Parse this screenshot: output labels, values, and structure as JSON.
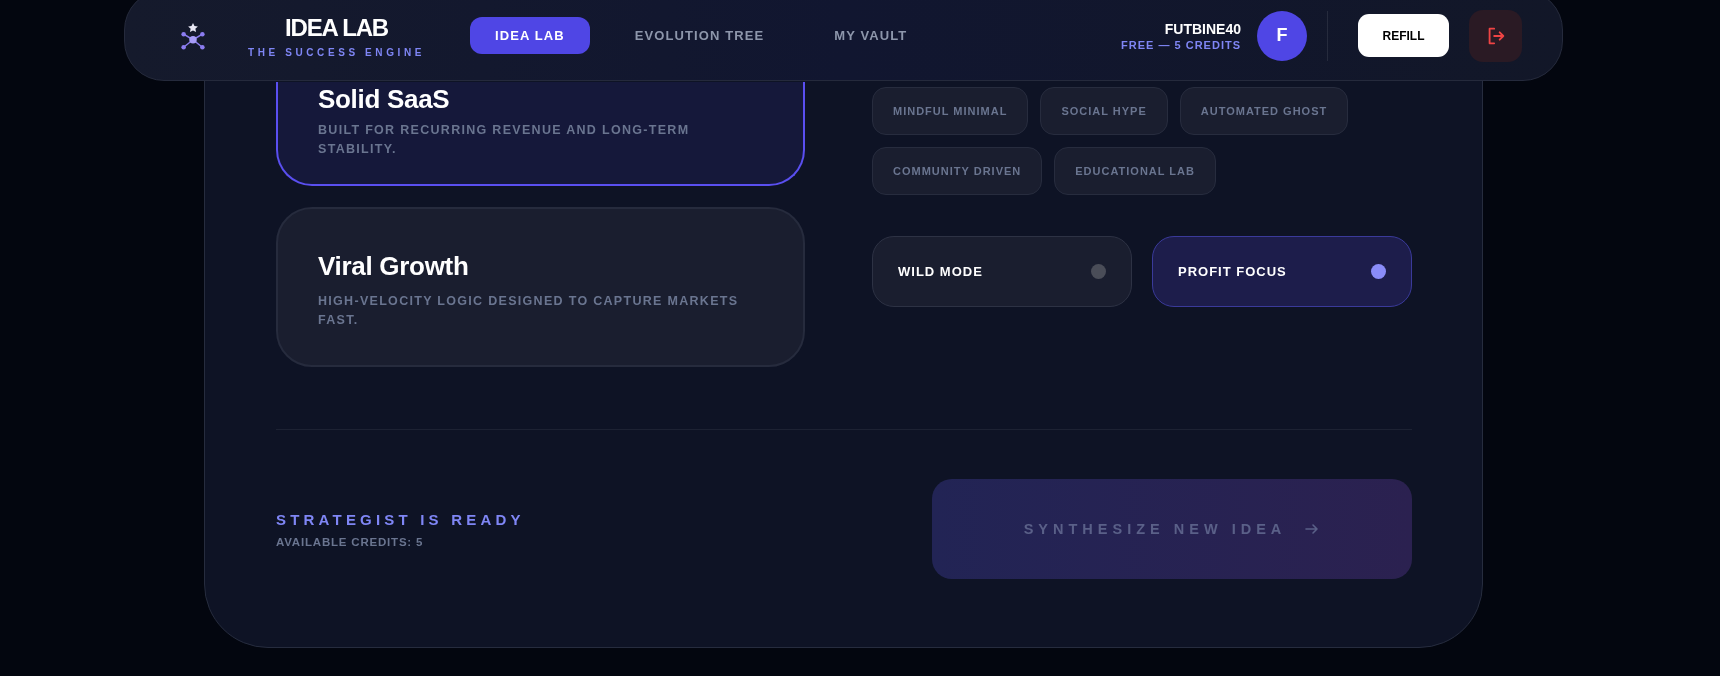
{
  "header": {
    "brand": {
      "title": "IDEA LAB",
      "subtitle": "THE SUCCESS ENGINE"
    },
    "nav": [
      {
        "label": "IDEA LAB",
        "selected": true
      },
      {
        "label": "EVOLUTION TREE",
        "selected": false
      },
      {
        "label": "MY VAULT",
        "selected": false
      }
    ],
    "user": {
      "name": "FUTBINE40",
      "plan": "FREE — 5 CREDITS",
      "avatar_initial": "F"
    },
    "refill_button": "REFILL"
  },
  "strategies": [
    {
      "title": "Solid SaaS",
      "description": "BUILT FOR RECURRING REVENUE AND LONG-TERM STABILITY.",
      "selected": true
    },
    {
      "title": "Viral Growth",
      "description": "HIGH-VELOCITY LOGIC DESIGNED TO CAPTURE MARKETS FAST.",
      "selected": false
    }
  ],
  "styles": [
    {
      "label": "MINDFUL MINIMAL",
      "selected": false
    },
    {
      "label": "SOCIAL HYPE",
      "selected": false
    },
    {
      "label": "AUTOMATED GHOST",
      "selected": false
    },
    {
      "label": "COMMUNITY DRIVEN",
      "selected": false
    },
    {
      "label": "EDUCATIONAL LAB",
      "selected": false
    }
  ],
  "toggles": [
    {
      "label": "WILD MODE",
      "on": false
    },
    {
      "label": "PROFIT FOCUS",
      "on": true
    }
  ],
  "footer": {
    "status": "STRATEGIST IS READY",
    "credits": "AVAILABLE CREDITS: 5",
    "action_button": {
      "label": "SYNTHESIZE NEW IDEA",
      "disabled": true
    }
  }
}
